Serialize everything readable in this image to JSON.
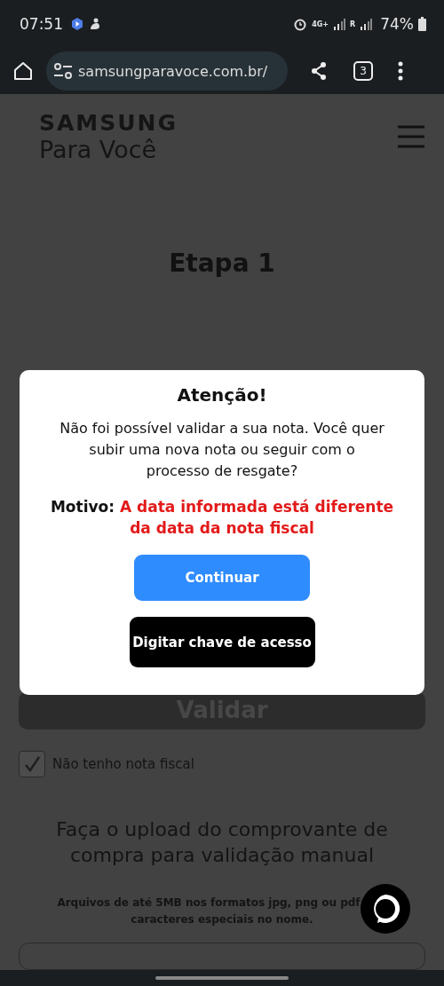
{
  "status_bar": {
    "time": "07:51",
    "network": "4G+",
    "roaming": "R",
    "battery": "74%"
  },
  "browser": {
    "url": "samsungparavoce.com.br/",
    "tab_count": "3"
  },
  "header": {
    "logo_top": "SAMSUNG",
    "logo_bottom": "Para Você"
  },
  "page": {
    "step_title": "Etapa 1",
    "validate_button": {
      "label": "Validar",
      "disabled": true
    },
    "no_invoice": {
      "label": "Não tenho nota fiscal",
      "checked": true
    },
    "upload_heading": "Faça o upload do comprovante de compra para validação manual",
    "upload_note": [
      "Arquivos de até 5MB nos formatos jpg, png ou pdf",
      "caracteres especiais no nome."
    ]
  },
  "dialog": {
    "title": "Atenção!",
    "message": "Não foi possível validar a sua nota. Você quer subir uma nova nota ou seguir com o processo de resgate?",
    "reason_label": "Motivo:",
    "reason": "A data informada está diferente da data da nota fiscal",
    "buttons": [
      {
        "label": "Continuar",
        "kind": "primary"
      },
      {
        "label": "Digitar chave de acesso",
        "kind": "dark"
      }
    ]
  }
}
